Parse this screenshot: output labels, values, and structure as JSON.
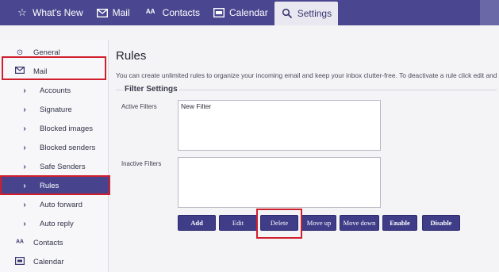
{
  "nav": {
    "tabs": [
      {
        "label": "What's New",
        "icon": "star-icon"
      },
      {
        "label": "Mail",
        "icon": "envelope-icon"
      },
      {
        "label": "Contacts",
        "icon": "contacts-icon"
      },
      {
        "label": "Calendar",
        "icon": "calendar-icon"
      },
      {
        "label": "Settings",
        "icon": "gear-icon"
      }
    ],
    "active": "Settings"
  },
  "sidebar": {
    "items": [
      {
        "label": "General",
        "icon": "gear-icon"
      },
      {
        "label": "Mail",
        "icon": "envelope-icon"
      },
      {
        "label": "Accounts",
        "icon": "chevron-right-icon"
      },
      {
        "label": "Signature",
        "icon": "chevron-right-icon"
      },
      {
        "label": "Blocked images",
        "icon": "chevron-right-icon"
      },
      {
        "label": "Blocked senders",
        "icon": "chevron-right-icon"
      },
      {
        "label": "Safe Senders",
        "icon": "chevron-right-icon"
      },
      {
        "label": "Rules",
        "icon": "chevron-right-icon"
      },
      {
        "label": "Auto forward",
        "icon": "chevron-right-icon"
      },
      {
        "label": "Auto reply",
        "icon": "chevron-right-icon"
      },
      {
        "label": "Contacts",
        "icon": "contacts-icon"
      },
      {
        "label": "Calendar",
        "icon": "calendar-icon"
      }
    ],
    "active": "Rules"
  },
  "main": {
    "title": "Rules",
    "description": "You can create unlimited rules to organize your incoming email and keep your inbox clutter-free. To deactivate a rule click edit and",
    "filter_settings": {
      "legend": "Filter Settings",
      "active_label": "Active Filters",
      "active_items": [
        "New Filter"
      ],
      "inactive_label": "Inactive Filters",
      "inactive_items": []
    },
    "buttons": {
      "add": "Add",
      "edit": "Edit",
      "delete": "Delete",
      "move_up": "Move up",
      "move_down": "Move down",
      "enable": "Enable",
      "disable": "Disable"
    }
  },
  "colors": {
    "nav_bg": "#4a4690",
    "sidebar_active": "#47438d",
    "button_bg": "#3f3c88",
    "highlight_red": "#d01f2c"
  }
}
